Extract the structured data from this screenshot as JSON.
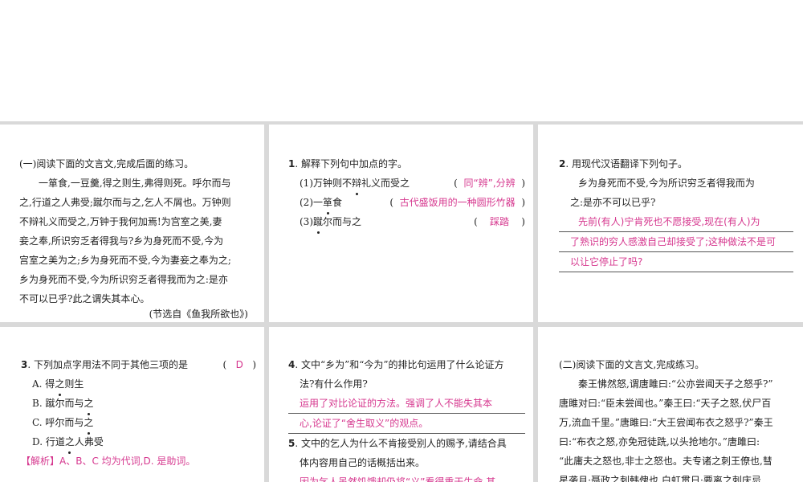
{
  "passage1": {
    "heading": "(一)阅读下面的文言文,完成后面的练习。",
    "lines": [
      "一箪食,一豆羹,得之则生,弗得则死。呼尔而与",
      "之,行道之人弗受;蹴尔而与之,乞人不屑也。万钟则",
      "不辩礼义而受之,万钟于我何加焉!为宫室之美,妻",
      "妾之奉,所识穷乏者得我与?乡为身死而不受,今为",
      "宫室之美为之;乡为身死而不受,今为妻妾之奉为之;",
      "乡为身死而不受,今为所识穷乏者得我而为之:是亦",
      "不可以已乎?此之谓失其本心。"
    ],
    "source": "(节选自《鱼我所欲也》)"
  },
  "q1": {
    "number": "1",
    "prompt": ". 解释下列句中加点的字。",
    "items": [
      {
        "num": "(1)",
        "pre": "万钟则不",
        "dotted": "辩",
        "post": "礼义而受之",
        "answer": "同“辨”,分辨"
      },
      {
        "num": "(2)",
        "pre": "一",
        "dotted": "箪",
        "post": "食",
        "answer": "古代盛饭用的一种圆形竹器"
      },
      {
        "num": "(3)",
        "pre": "",
        "dotted": "蹴",
        "post": "尔而与之",
        "answer": "踩踏"
      }
    ]
  },
  "q2": {
    "number": "2",
    "prompt": ". 用现代汉语翻译下列句子。",
    "sentence_lines": [
      "乡为身死而不受,今为所识穷乏者得我而为",
      "之:是亦不可以已乎?"
    ],
    "answer_lines": [
      "先前(有人)宁肯死也不愿接受,现在(有人)为",
      "了熟识的穷人感激自己却接受了;这种做法不是可",
      "以让它停止了吗?"
    ]
  },
  "q3": {
    "number": "3",
    "prompt": ". 下列加点字用法不同于其他三项的是",
    "answer": "D",
    "options": [
      {
        "label": "A. ",
        "pre": "得",
        "dotted": "之",
        "post": "则生"
      },
      {
        "label": "B. ",
        "pre": "蹴尔而与",
        "dotted": "之",
        "post": ""
      },
      {
        "label": "C. ",
        "pre": "呼尔而与",
        "dotted": "之",
        "post": ""
      },
      {
        "label": "D. ",
        "pre": "行道",
        "dotted": "之",
        "post": "人弗受"
      }
    ],
    "analysis": "【解析】A、B、C 均为代词,D. 是助词。"
  },
  "q4": {
    "number": "4",
    "prompt_lines": [
      ". 文中“乡为”和“今为”的排比句运用了什么论证方",
      "法?有什么作用?"
    ],
    "answer_lines": [
      "运用了对比论证的方法。强调了人不能失其本",
      "心,论证了“舍生取义”的观点。"
    ]
  },
  "q5": {
    "number": "5",
    "prompt_lines": [
      ". 文中的乞人为什么不肯接受别人的赐予,请结合具",
      "体内容用自己的话概括出来。"
    ],
    "answer_lines": [
      "因为乞人虽然饥饿却仍将“义”看得重于生命,甚"
    ]
  },
  "passage2": {
    "heading": "(二)阅读下面的文言文,完成练习。",
    "lines": [
      "秦王怫然怒,谓唐雎曰:“公亦尝闻天子之怒乎?”",
      "唐雎对曰:“臣未尝闻也。”秦王曰:“天子之怒,伏尸百",
      "万,流血千里。”唐雎曰:“大王尝闻布衣之怒乎?”秦王",
      "曰:“布衣之怒,亦免冠徒跣,以头抢地尔。”唐雎曰:",
      "“此庸夫之怒也,非士之怒也。夫专诸之刺王僚也,彗",
      "星袭月;聂政之刺韩傀也,白虹贯日;要离之刺庆忌"
    ]
  }
}
